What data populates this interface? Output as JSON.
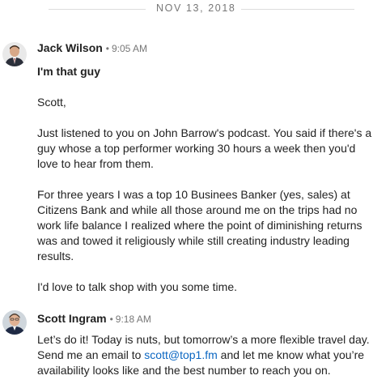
{
  "date_divider": "NOV 13, 2018",
  "messages": [
    {
      "sender": "Jack Wilson",
      "separator": "•",
      "time": "9:05 AM",
      "subject": "I'm that guy",
      "paragraphs": [
        "Scott,",
        "Just listened to you on John Barrow's podcast. You said if there's a\nguy whose a top performer working 30 hours a week then you'd\nlove to hear from them.",
        "For three years I was a top 10 Businees Banker (yes, sales) at\nCitizens Bank and while all those around me on the trips had no\nwork life balance I realized where the point of diminishing returns\nwas and towed it religiously while still creating industry leading\nresults.",
        "I'd love to talk shop with you some time."
      ]
    },
    {
      "sender": "Scott Ingram",
      "separator": "•",
      "time": "9:18 AM",
      "text_before_link": "Let’s do it! Today is nuts, but tomorrow’s a more flexible travel day.\nSend me an email to ",
      "link_text": "scott@top1.fm",
      "text_after_link": " and let me know what you’re\navailability looks like and the best number to reach you on."
    }
  ],
  "colors": {
    "link": "#0a66c2",
    "timestamp": "#777777",
    "text": "#222222"
  }
}
